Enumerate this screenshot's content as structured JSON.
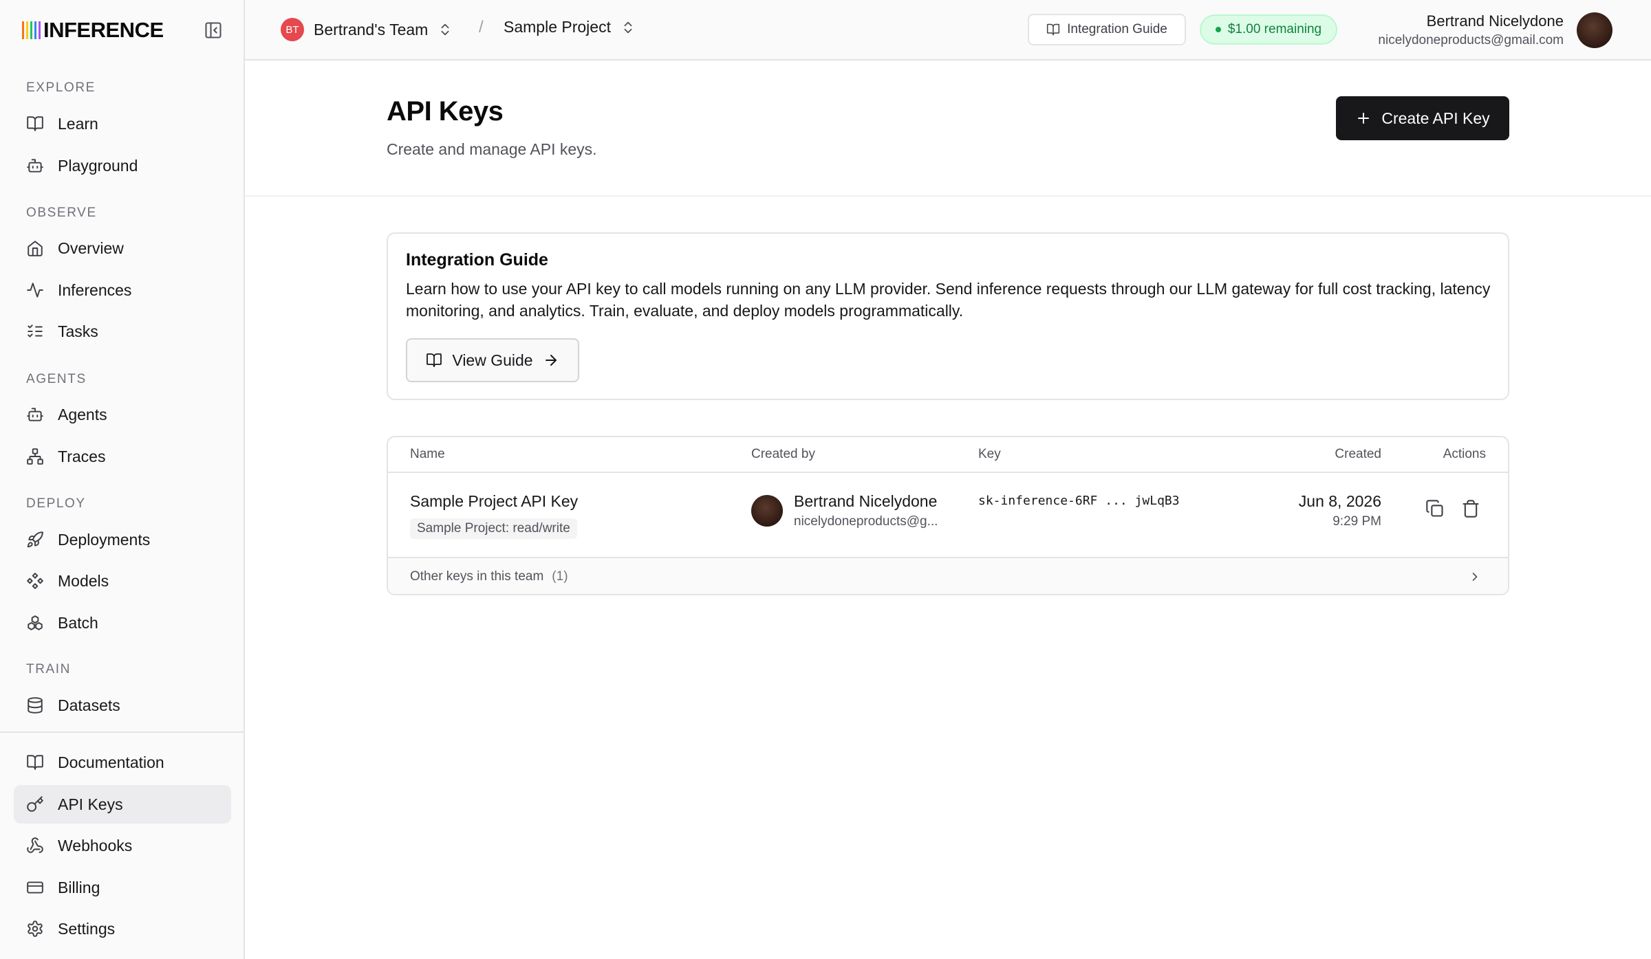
{
  "brand": {
    "name": "INFERENCE",
    "bar_colors": [
      "#f97316",
      "#facc15",
      "#22c55e",
      "#3b82f6",
      "#a855f7"
    ]
  },
  "sidebar": {
    "sections": [
      {
        "title": "EXPLORE",
        "items": [
          {
            "label": "Learn",
            "icon": "book-icon"
          },
          {
            "label": "Playground",
            "icon": "bot-icon"
          }
        ]
      },
      {
        "title": "OBSERVE",
        "items": [
          {
            "label": "Overview",
            "icon": "home-icon"
          },
          {
            "label": "Inferences",
            "icon": "activity-icon"
          },
          {
            "label": "Tasks",
            "icon": "list-checks-icon"
          }
        ]
      },
      {
        "title": "AGENTS",
        "items": [
          {
            "label": "Agents",
            "icon": "bot-icon"
          },
          {
            "label": "Traces",
            "icon": "network-icon"
          }
        ]
      },
      {
        "title": "DEPLOY",
        "items": [
          {
            "label": "Deployments",
            "icon": "rocket-icon"
          },
          {
            "label": "Models",
            "icon": "workflow-icon"
          },
          {
            "label": "Batch",
            "icon": "boxes-icon"
          }
        ]
      },
      {
        "title": "TRAIN",
        "items": [
          {
            "label": "Datasets",
            "icon": "database-icon"
          }
        ]
      }
    ],
    "bottom_items": [
      {
        "label": "Documentation",
        "icon": "book-icon"
      },
      {
        "label": "API Keys",
        "icon": "key-icon",
        "active": true
      },
      {
        "label": "Webhooks",
        "icon": "webhook-icon"
      },
      {
        "label": "Billing",
        "icon": "credit-card-icon"
      },
      {
        "label": "Settings",
        "icon": "settings-icon"
      }
    ]
  },
  "header": {
    "team_initials": "BT",
    "team_name": "Bertrand's Team",
    "separator": "/",
    "project_name": "Sample Project",
    "guide_button": "Integration Guide",
    "credit": "$1.00 remaining",
    "credit_color": "#16a34a",
    "user_name": "Bertrand Nicelydone",
    "user_email": "nicelydoneproducts@gmail.com"
  },
  "page": {
    "title": "API Keys",
    "subtitle": "Create and manage API keys.",
    "create_button": "Create API Key"
  },
  "guide_card": {
    "title": "Integration Guide",
    "body": "Learn how to use your API key to call models running on any LLM provider. Send inference requests through our LLM gateway for full cost tracking, latency monitoring, and analytics. Train, evaluate, and deploy models programmatically.",
    "button": "View Guide"
  },
  "table": {
    "columns": {
      "name": "Name",
      "created_by": "Created by",
      "key": "Key",
      "created": "Created",
      "actions": "Actions"
    },
    "rows": [
      {
        "name": "Sample Project API Key",
        "scope": "Sample Project: read/write",
        "creator_name": "Bertrand Nicelydone",
        "creator_email": "nicelydoneproducts@g...",
        "key": "sk-inference-6RF ... jwLqB3",
        "created_date": "Jun 8, 2026",
        "created_time": "9:29 PM"
      }
    ],
    "other_keys_label": "Other keys in this team",
    "other_keys_count": "(1)"
  }
}
